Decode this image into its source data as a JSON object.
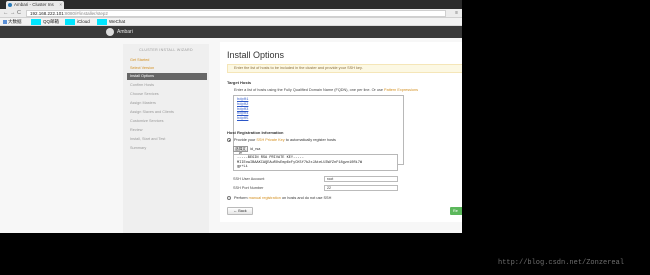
{
  "browser": {
    "tab_title": "Ambari - Cluster Ins",
    "close_glyph": "×",
    "url_host": "192.168.222.101",
    "url_path": ":8080/#/installer/step2",
    "back_glyph": "←",
    "forward_glyph": "→",
    "reload_glyph": "C",
    "menu_glyph": "≡"
  },
  "bookmarks": [
    {
      "label": "大数据",
      "icon": "folder-icon"
    },
    {
      "label": "QQ邮箱",
      "icon": "mail-icon"
    },
    {
      "label": "iCloud",
      "icon": "cloud-icon"
    },
    {
      "label": "WeChat",
      "icon": "chat-icon"
    }
  ],
  "header": {
    "app_name": "Ambari"
  },
  "sidebar": {
    "title": "CLUSTER INSTALL WIZARD",
    "items": [
      {
        "label": "Get Started",
        "state": "done"
      },
      {
        "label": "Select Version",
        "state": "done"
      },
      {
        "label": "Install Options",
        "state": "active"
      },
      {
        "label": "Confirm Hosts",
        "state": "pending"
      },
      {
        "label": "Choose Services",
        "state": "pending"
      },
      {
        "label": "Assign Masters",
        "state": "pending"
      },
      {
        "label": "Assign Slaves and Clients",
        "state": "pending"
      },
      {
        "label": "Customize Services",
        "state": "pending"
      },
      {
        "label": "Review",
        "state": "pending"
      },
      {
        "label": "Install, Start and Test",
        "state": "pending"
      },
      {
        "label": "Summary",
        "state": "pending"
      }
    ]
  },
  "main": {
    "title": "Install Options",
    "info": "Enter the list of hosts to be included in the cluster and provide your SSH key.",
    "target_hosts_heading": "Target Hosts",
    "target_hosts_desc_a": "Enter a list of hosts using the Fully Qualified Domain Name (FQDN), one per line. Or use",
    "target_hosts_desc_link": "Pattern Expressions",
    "hosts": [
      "hdp01",
      "hdp02",
      "hdp03",
      "hdp04",
      "hdp05"
    ],
    "registration_heading": "Host Registration Information",
    "opt1_a": "Provide your",
    "opt1_link": "SSH Private Key",
    "opt1_b": "to automatically register hosts",
    "choose_file": "选择文件",
    "file_name": "id_rsa",
    "key_lines": [
      "-----BEGIN RSA PRIVATE KEY-----",
      "MIIEowIBAAKCAQEAuROsEmp6cFyCK5f7b2xJAteLU3WYZnF18gzn10Ri7W",
      "gp+Li"
    ],
    "ssh_user_label": "SSH User Account",
    "ssh_user_value": "root",
    "ssh_port_label": "SSH Port Number",
    "ssh_port_value": "22",
    "opt2_a": "Perform",
    "opt2_link": "manual registration",
    "opt2_b": "on hosts and do not use SSH",
    "back_label": "← Back",
    "next_label": "Re"
  },
  "watermark": "http://blog.csdn.net/Zonzereal",
  "colors": {
    "accent": "#d38f1f",
    "next": "#5cb85c",
    "bookmark_block": "#00e5ff"
  }
}
